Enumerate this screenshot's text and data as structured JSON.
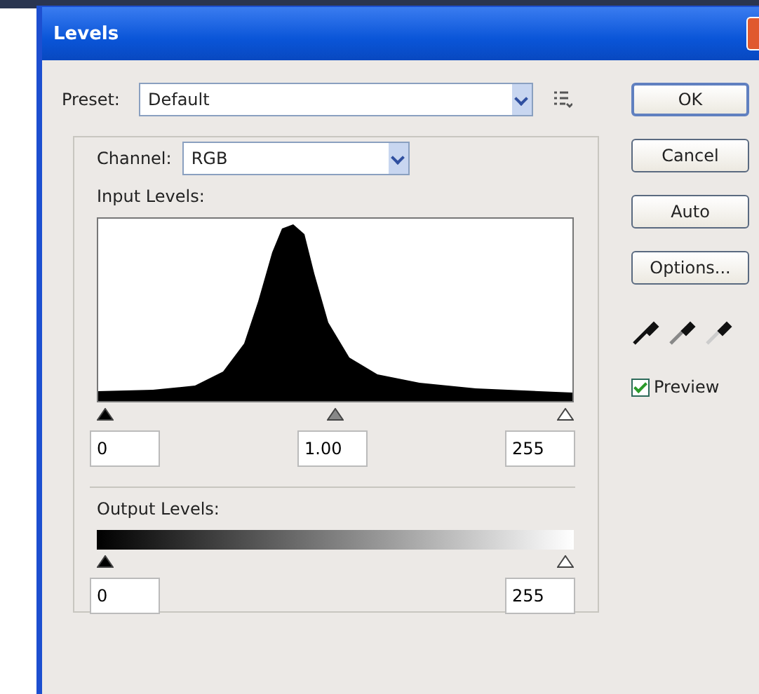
{
  "window": {
    "title": "Levels"
  },
  "preset": {
    "label": "Preset:",
    "value": "Default"
  },
  "channel": {
    "label": "Channel:",
    "value": "RGB"
  },
  "input_levels": {
    "label": "Input Levels:",
    "handles": [
      {
        "kind": "black",
        "level": 0
      },
      {
        "kind": "gray",
        "level": 0.5
      },
      {
        "kind": "white",
        "level": 1
      }
    ],
    "fields": [
      "0",
      "1.00",
      "255"
    ]
  },
  "output_levels": {
    "label": "Output Levels:",
    "handles": [
      {
        "kind": "black",
        "level": 0
      },
      {
        "kind": "white",
        "level": 1
      }
    ],
    "fields": [
      "0",
      "255"
    ]
  },
  "buttons": [
    "OK",
    "Cancel",
    "Auto",
    "Options..."
  ],
  "preview": {
    "label": "Preview",
    "checked": true
  }
}
